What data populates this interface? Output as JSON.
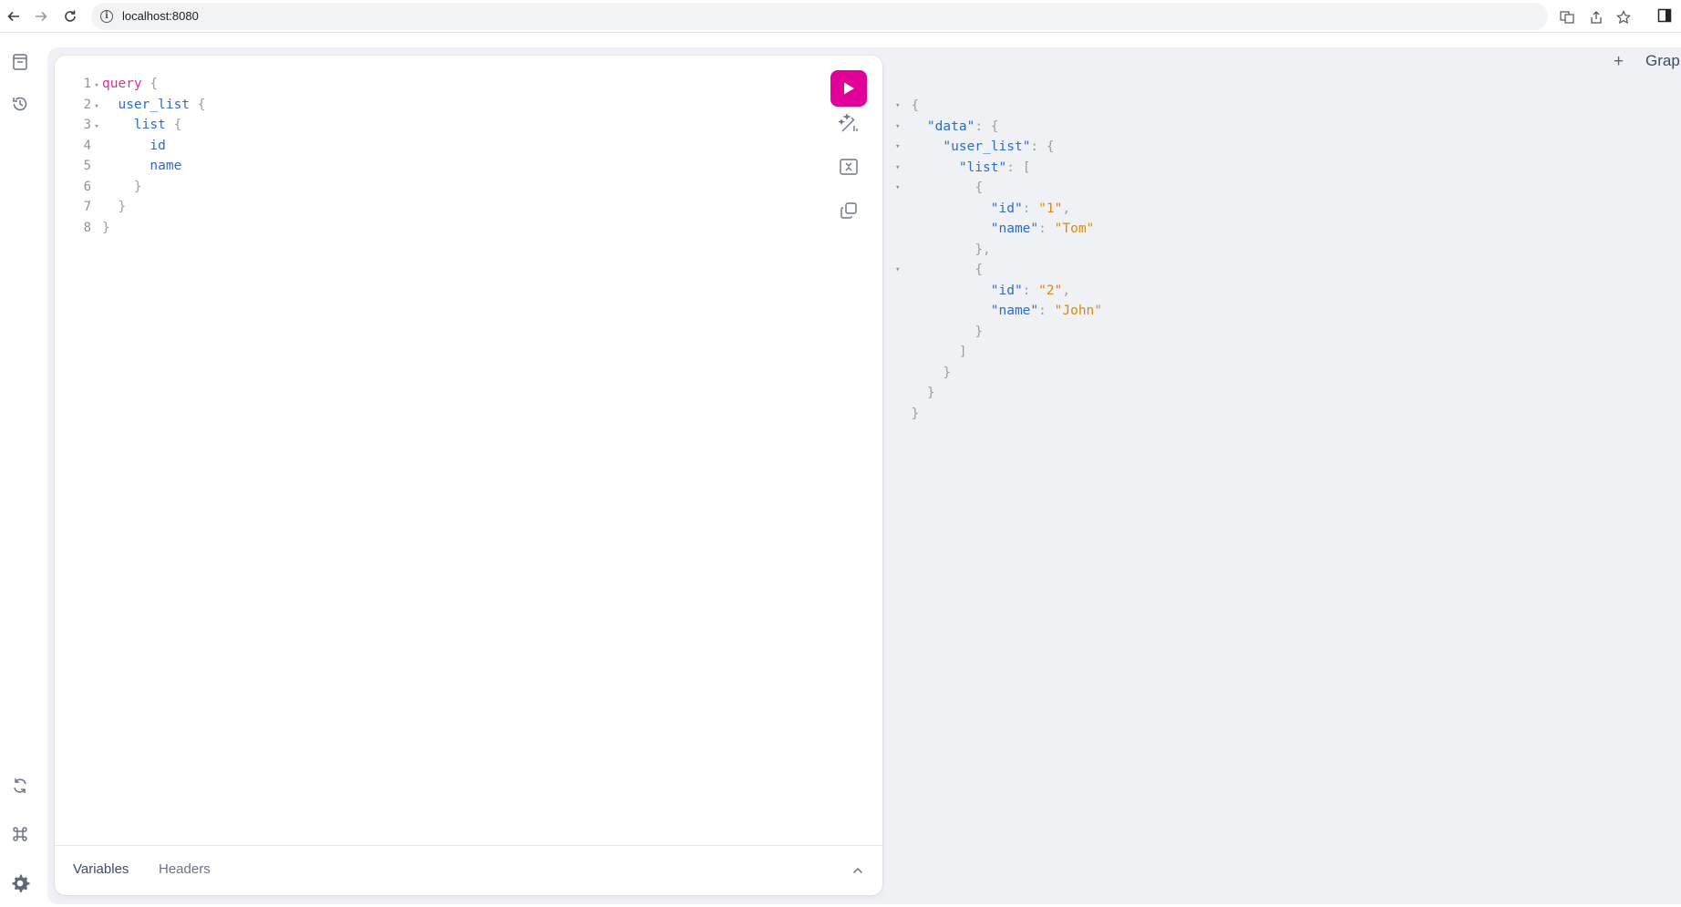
{
  "browser": {
    "url": "localhost:8080"
  },
  "sidebar": {
    "items": [
      {
        "name": "docs-icon"
      },
      {
        "name": "history-icon"
      },
      {
        "name": "refetch-schema-icon"
      },
      {
        "name": "shortcuts-icon"
      },
      {
        "name": "settings-icon"
      }
    ]
  },
  "editor": {
    "lines": [
      {
        "n": "1",
        "text": "query {"
      },
      {
        "n": "2",
        "text": "user_list {"
      },
      {
        "n": "3",
        "text": "list {"
      },
      {
        "n": "4",
        "text": "id"
      },
      {
        "n": "5",
        "text": "name"
      },
      {
        "n": "6",
        "text": "}"
      },
      {
        "n": "7",
        "text": "}"
      },
      {
        "n": "8",
        "text": "}"
      }
    ],
    "tabs": {
      "variables": "Variables",
      "headers": "Headers"
    }
  },
  "result": {
    "data_key": "\"data\"",
    "user_list_key": "\"user_list\"",
    "list_key": "\"list\"",
    "items": [
      {
        "id_key": "\"id\"",
        "id_val": "\"1\"",
        "name_key": "\"name\"",
        "name_val": "\"Tom\""
      },
      {
        "id_key": "\"id\"",
        "id_val": "\"2\"",
        "name_key": "\"name\"",
        "name_val": "\"John\""
      }
    ]
  },
  "header": {
    "add_tab": "+",
    "title": "Grap"
  },
  "colors": {
    "accent": "#e10098",
    "keyword": "#d6338c",
    "field": "#2e6bc4",
    "string": "#d68a0e",
    "panel_bg": "#f0f1f4"
  }
}
